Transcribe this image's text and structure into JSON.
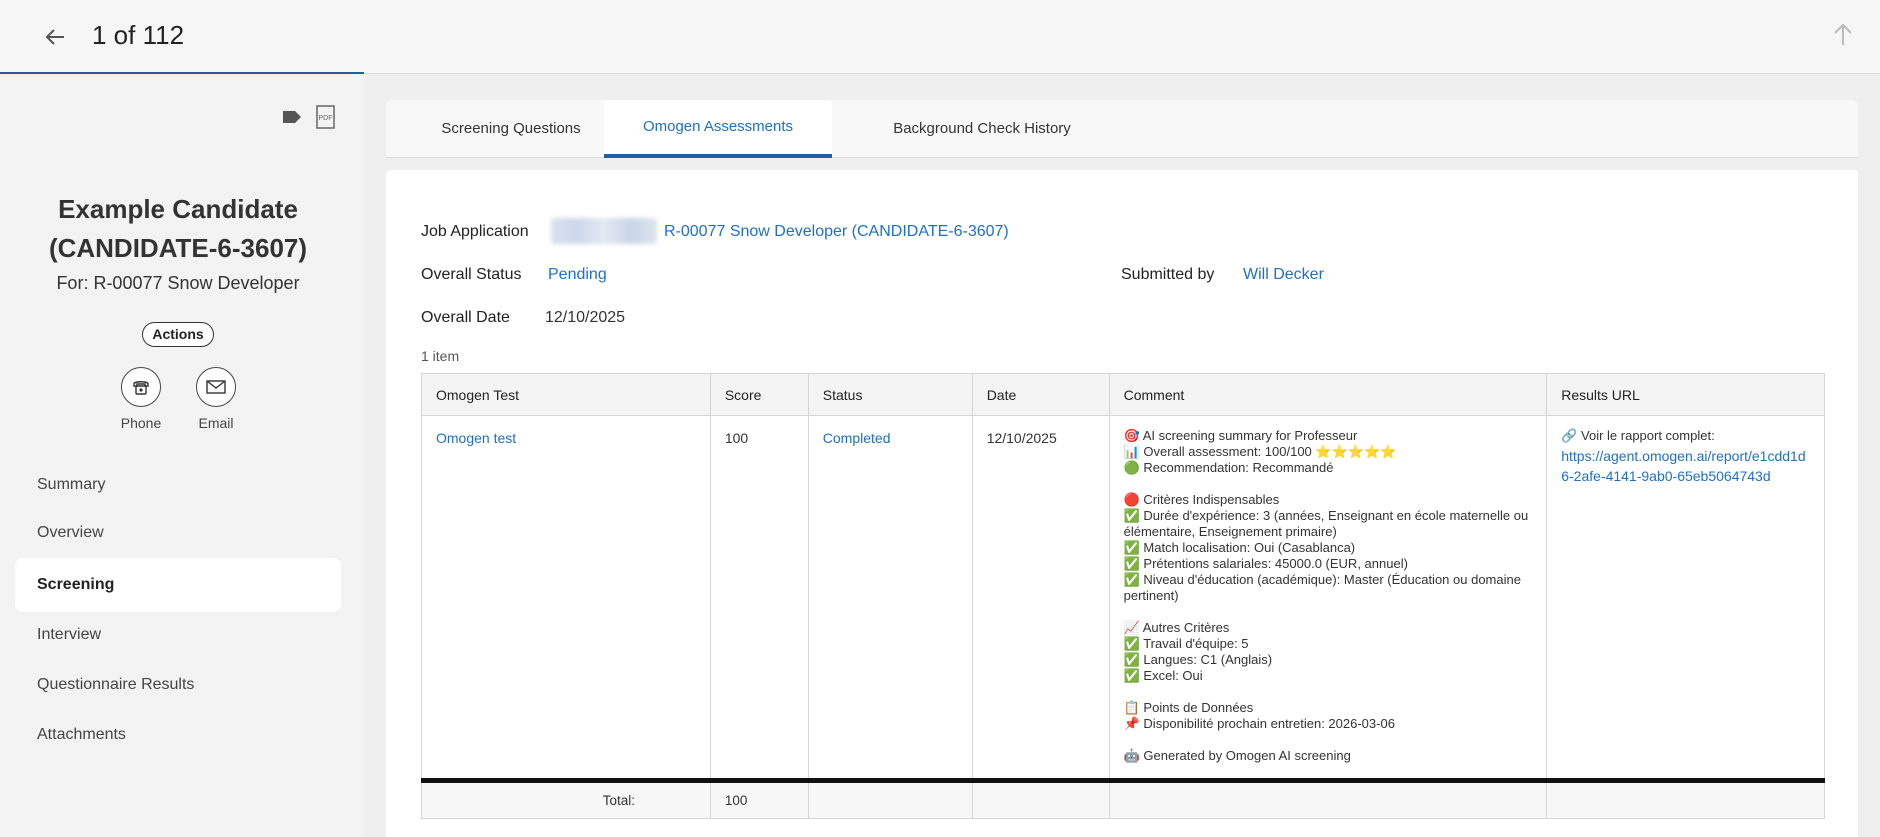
{
  "header": {
    "counter": "1 of 112"
  },
  "candidate": {
    "name": "Example Candidate (CANDIDATE-6-3607)",
    "for_label": "For: R-00077 Snow Developer",
    "actions_label": "Actions",
    "phone_label": "Phone",
    "email_label": "Email"
  },
  "sidebar": {
    "items": [
      {
        "label": "Summary"
      },
      {
        "label": "Overview"
      },
      {
        "label": "Screening"
      },
      {
        "label": "Interview"
      },
      {
        "label": "Questionnaire Results"
      },
      {
        "label": "Attachments"
      }
    ],
    "active": "Screening"
  },
  "tabs": [
    {
      "label": "Screening Questions"
    },
    {
      "label": "Omogen Assessments"
    },
    {
      "label": "Background Check History"
    }
  ],
  "details": {
    "job_application_label": "Job Application",
    "job_application_value": "R-00077 Snow Developer (CANDIDATE-6-3607)",
    "overall_status_label": "Overall Status",
    "overall_status_value": "Pending",
    "submitted_by_label": "Submitted by",
    "submitted_by_value": "Will Decker",
    "overall_date_label": "Overall Date",
    "overall_date_value": "12/10/2025",
    "item_count": "1 item"
  },
  "table": {
    "headers": [
      "Omogen Test",
      "Score",
      "Status",
      "Date",
      "Comment",
      "Results URL"
    ],
    "row": {
      "test": "Omogen test",
      "score": "100",
      "status": "Completed",
      "date": "12/10/2025",
      "comment_lines": [
        "🎯 AI screening summary for Professeur",
        "📊  Overall assessment: 100/100 ⭐⭐⭐⭐⭐",
        "🟢 Recommendation: Recommandé",
        "",
        "🔴 Critères Indispensables",
        "✅  Durée d'expérience: 3 (années, Enseignant en école maternelle ou élémentaire, Enseignement primaire)",
        "✅  Match localisation: Oui (Casablanca)",
        "✅  Prétentions salariales: 45000.0 (EUR, annuel)",
        "✅  Niveau d'éducation (académique): Master (Éducation ou domaine pertinent)",
        "",
        "📈 Autres Critères",
        "✅  Travail d'équipe: 5",
        "✅  Langues: C1 (Anglais)",
        "✅  Excel: Oui",
        "",
        "📋 Points de Données",
        "📌  Disponibilité prochain entretien: 2026-03-06",
        "",
        "🤖 Generated by Omogen AI screening"
      ],
      "results_prefix": "🔗 Voir le rapport complet:",
      "results_url": "https://agent.omogen.ai/report/e1cdd1d6-2afe-4141-9ab0-65eb5064743d"
    },
    "total_label": "Total:",
    "total_value": "100"
  },
  "colors": {
    "accent": "#1f5fa6",
    "link": "#1f6fc6"
  }
}
